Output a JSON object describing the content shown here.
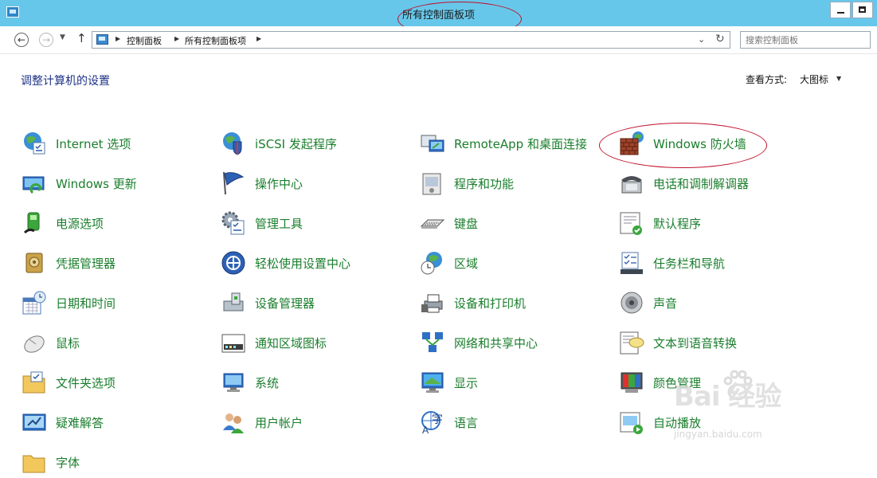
{
  "window": {
    "title": "所有控制面板项"
  },
  "navigation": {
    "breadcrumbs": [
      "控制面板",
      "所有控制面板项"
    ],
    "search_placeholder": "搜索控制面板"
  },
  "header": {
    "title": "调整计算机的设置",
    "view_by_label": "查看方式:",
    "view_by_value": "大图标"
  },
  "items": [
    {
      "label": "Internet 选项",
      "icon": "internet-options-icon"
    },
    {
      "label": "Windows 更新",
      "icon": "windows-update-icon"
    },
    {
      "label": "电源选项",
      "icon": "power-options-icon"
    },
    {
      "label": "凭据管理器",
      "icon": "credential-manager-icon"
    },
    {
      "label": "日期和时间",
      "icon": "date-time-icon"
    },
    {
      "label": "鼠标",
      "icon": "mouse-icon"
    },
    {
      "label": "文件夹选项",
      "icon": "folder-options-icon"
    },
    {
      "label": "疑难解答",
      "icon": "troubleshooting-icon"
    },
    {
      "label": "字体",
      "icon": "fonts-icon"
    },
    {
      "label": "iSCSI 发起程序",
      "icon": "iscsi-initiator-icon"
    },
    {
      "label": "操作中心",
      "icon": "action-center-icon"
    },
    {
      "label": "管理工具",
      "icon": "administrative-tools-icon"
    },
    {
      "label": "轻松使用设置中心",
      "icon": "ease-of-access-icon"
    },
    {
      "label": "设备管理器",
      "icon": "device-manager-icon"
    },
    {
      "label": "通知区域图标",
      "icon": "notification-area-icon"
    },
    {
      "label": "系统",
      "icon": "system-icon"
    },
    {
      "label": "用户帐户",
      "icon": "user-accounts-icon"
    },
    {
      "label": "RemoteApp 和桌面连接",
      "icon": "remoteapp-icon"
    },
    {
      "label": "程序和功能",
      "icon": "programs-features-icon"
    },
    {
      "label": "键盘",
      "icon": "keyboard-icon"
    },
    {
      "label": "区域",
      "icon": "region-icon"
    },
    {
      "label": "设备和打印机",
      "icon": "devices-printers-icon"
    },
    {
      "label": "网络和共享中心",
      "icon": "network-sharing-icon"
    },
    {
      "label": "显示",
      "icon": "display-icon"
    },
    {
      "label": "语言",
      "icon": "language-icon"
    },
    {
      "label": "Windows 防火墙",
      "icon": "firewall-icon"
    },
    {
      "label": "电话和调制解调器",
      "icon": "phone-modem-icon"
    },
    {
      "label": "默认程序",
      "icon": "default-programs-icon"
    },
    {
      "label": "任务栏和导航",
      "icon": "taskbar-navigation-icon"
    },
    {
      "label": "声音",
      "icon": "sound-icon"
    },
    {
      "label": "文本到语音转换",
      "icon": "text-to-speech-icon"
    },
    {
      "label": "颜色管理",
      "icon": "color-management-icon"
    },
    {
      "label": "自动播放",
      "icon": "autoplay-icon"
    }
  ],
  "watermark": {
    "logo": "Bai 经验",
    "url": "jingyan.baidu.com"
  }
}
